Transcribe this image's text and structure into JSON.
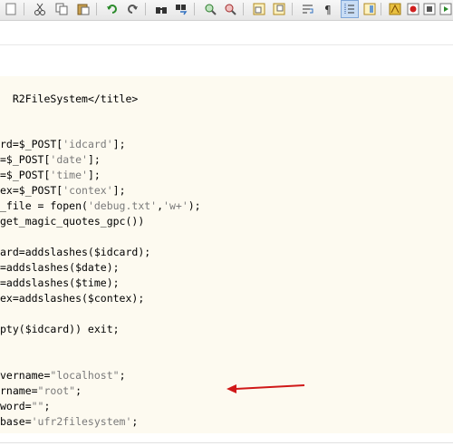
{
  "toolbar": {
    "icons": [
      "new-file-icon",
      "cut-icon",
      "copy-icon",
      "paste-icon",
      "undo-icon",
      "redo-icon",
      "find-icon",
      "replace-icon",
      "zoom-in-icon",
      "zoom-out-icon",
      "sync-vertical-icon",
      "sync-horizontal-icon",
      "word-wrap-icon",
      "show-all-chars-icon",
      "indent-guide-icon",
      "doc-map-icon",
      "function-list-icon",
      "macro-record-icon",
      "macro-stop-icon",
      "macro-play-icon",
      "macro-save-icon"
    ]
  },
  "code": {
    "l1": "R2FileSystem</title>",
    "l2a": "rd=$_POST[",
    "l2b": "'idcard'",
    "l2c": "];",
    "l3a": "=$_POST[",
    "l3b": "'date'",
    "l3c": "];",
    "l4a": "=$_POST[",
    "l4b": "'time'",
    "l4c": "];",
    "l5a": "ex=$_POST[",
    "l5b": "'contex'",
    "l5c": "];",
    "l6a": "_file = fopen(",
    "l6b": "'debug.txt'",
    "l6c": ",",
    "l6d": "'w+'",
    "l6e": ");",
    "l7": "get_magic_quotes_gpc())",
    "l8": "ard=addslashes($idcard);",
    "l9": "=addslashes($date);",
    "l10": "=addslashes($time);",
    "l11": "ex=addslashes($contex);",
    "l12": "pty($idcard)) exit;",
    "l13a": "vername=",
    "l13b": "\"localhost\"",
    "l13c": ";",
    "l14a": "rname=",
    "l14b": "\"root\"",
    "l14c": ";",
    "l15a": "word=",
    "l15b": "\"\"",
    "l15c": ";",
    "l16a": "base=",
    "l16b": "'ufr2filesystem'",
    "l16c": ";"
  },
  "colors": {
    "php_background": "#fdfaf0",
    "arrow": "#d01818",
    "string": "#7a7a7a"
  }
}
